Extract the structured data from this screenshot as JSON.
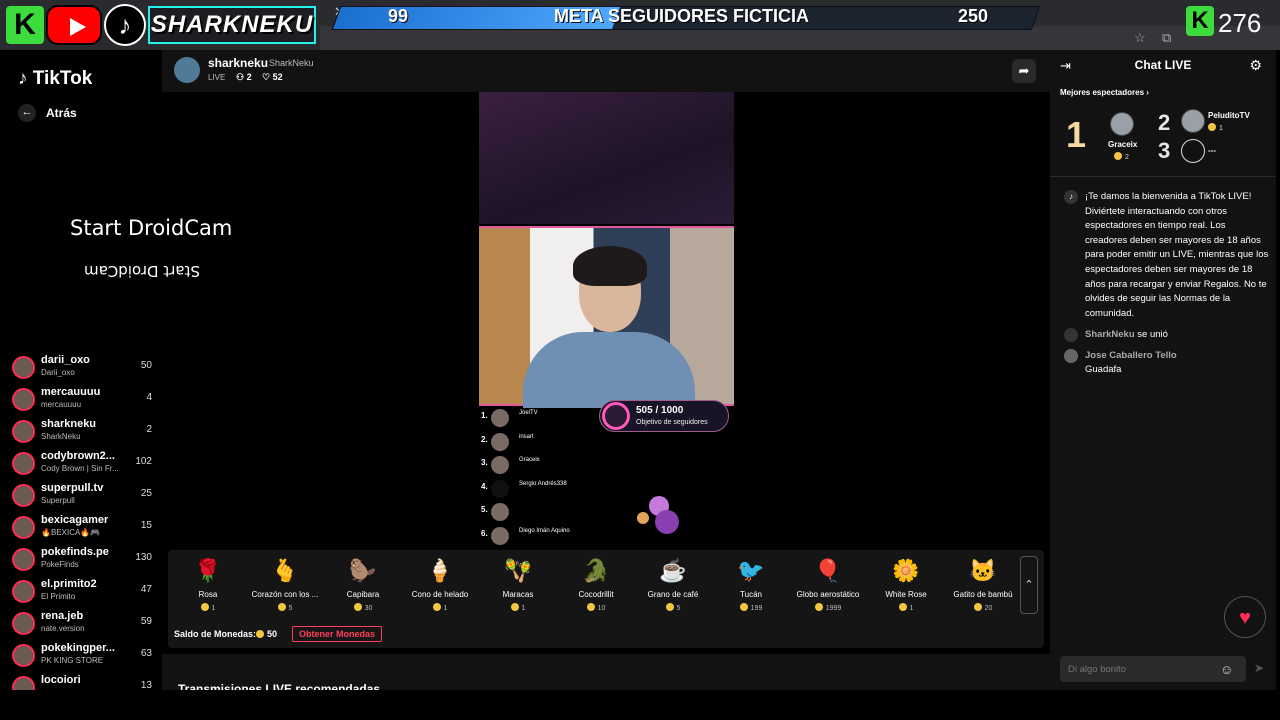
{
  "overlay": {
    "brand_name": "SHARKNEKU",
    "meta_left": "99",
    "meta_title": "META SEGUIDORES FICTICIA",
    "meta_right": "250",
    "meta_progress": 0.4,
    "k_count": "276"
  },
  "sidebar": {
    "logo": "TikTok",
    "back_label": "Atrás",
    "droidcam_title": "Start DroidCam",
    "droidcam_mirror": "Start DroidCam",
    "lives": [
      {
        "name": "darii_oxo",
        "sub": "Darii_oxo",
        "count": "50"
      },
      {
        "name": "mercauuuu",
        "sub": "mercauuuu",
        "count": "4"
      },
      {
        "name": "sharkneku",
        "sub": "SharkNeku",
        "count": "2"
      },
      {
        "name": "codybrown2...",
        "sub": "Cody Brown | Sin Fr...",
        "count": "102"
      },
      {
        "name": "superpull.tv",
        "sub": "Superpull",
        "count": "25"
      },
      {
        "name": "bexicagamer",
        "sub": "🔥BEXICA🔥🎮",
        "count": "15"
      },
      {
        "name": "pokefinds.pe",
        "sub": "PokeFinds",
        "count": "130"
      },
      {
        "name": "el.primito2",
        "sub": "El Primito",
        "count": "47"
      },
      {
        "name": "rena.jeb",
        "sub": "nate.version",
        "count": "59"
      },
      {
        "name": "pokekingper...",
        "sub": "PK KING STORE",
        "count": "63"
      },
      {
        "name": "locoiori",
        "sub": "",
        "count": "13"
      }
    ]
  },
  "stream": {
    "host_name": "sharkneku",
    "host_handle": "SharkNeku",
    "live_label": "LIVE",
    "viewers": "2",
    "likes": "52",
    "goal_nums": "505 / 1000",
    "goal_label": "Objetivo de seguidores",
    "ranking": [
      {
        "num": "1.",
        "name": "JoelTV"
      },
      {
        "num": "2.",
        "name": "insart"
      },
      {
        "num": "3.",
        "name": "Graceix"
      },
      {
        "num": "4.",
        "name": "Sergio Andrés338"
      },
      {
        "num": "5.",
        "name": ""
      },
      {
        "num": "6.",
        "name": "Diego Imán Aquino"
      }
    ]
  },
  "gifts": [
    {
      "name": "Rosa",
      "price": "1",
      "icon": "🌹"
    },
    {
      "name": "Corazón con los ...",
      "price": "5",
      "icon": "🫰"
    },
    {
      "name": "Capibara",
      "price": "30",
      "icon": "🦫"
    },
    {
      "name": "Cono de helado",
      "price": "1",
      "icon": "🍦"
    },
    {
      "name": "Maracas",
      "price": "1",
      "icon": "🪇"
    },
    {
      "name": "Cocodrillit",
      "price": "10",
      "icon": "🐊"
    },
    {
      "name": "Grano de café",
      "price": "5",
      "icon": "☕"
    },
    {
      "name": "Tucán",
      "price": "199",
      "icon": "🐦"
    },
    {
      "name": "Globo aerostático",
      "price": "1999",
      "icon": "🎈"
    },
    {
      "name": "White Rose",
      "price": "1",
      "icon": "🌼"
    },
    {
      "name": "Gatito de bambú",
      "price": "20",
      "icon": "🐱"
    }
  ],
  "wallet": {
    "balance_label": "Saldo de Monedas:",
    "balance_value": "50",
    "get_coins": "Obtener Monedas"
  },
  "recommended_title": "Transmisiones LIVE recomendadas",
  "chat": {
    "title": "Chat LIVE",
    "top_viewers_label": "Mejores espectadores",
    "top1_rank": "1",
    "top1_name": "Graceix",
    "top1_coins": "2",
    "top2_rank": "2",
    "top2_name": "PeluditoTV",
    "top2_coins": "1",
    "top3_rank": "3",
    "top3_name": "---",
    "welcome": "¡Te damos la bienvenida a TikTok LIVE! Diviértete interactuando con otros espectadores en tiempo real. Los creadores deben ser mayores de 18 años para poder emitir un LIVE, mientras que los espectadores deben ser mayores de 18 años para recargar y enviar Regalos. No te olvides de seguir las Normas de la comunidad.",
    "joined_user": "SharkNeku",
    "joined_text": "se unió",
    "msg_user": "Jose Caballero Tello",
    "msg_text": "Guadafa",
    "input_placeholder": "Di algo bonito"
  }
}
